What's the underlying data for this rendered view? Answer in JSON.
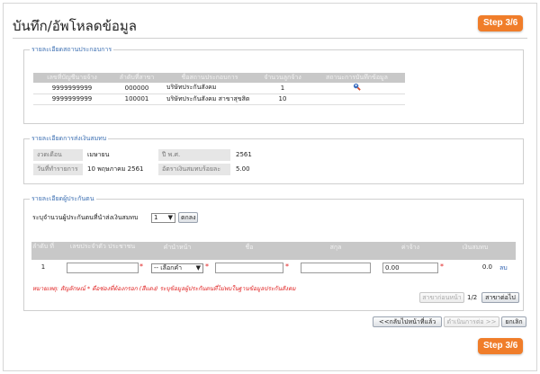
{
  "header": {
    "title": "บันทึก/อัพโหลดข้อมูล",
    "step": "Step 3/6"
  },
  "section1": {
    "legend": "รายละเอียดสถานประกอบการ",
    "columns": [
      "เลขที่บัญชีนายจ้าง",
      "ลำดับที่สาขา",
      "ชื่อสถานประกอบการ",
      "จำนวนลูกจ้าง",
      "สถานะการบันทึกข้อมูล"
    ],
    "rows": [
      {
        "account": "9999999999",
        "branch": "000000",
        "name": "บริษัทประกันสังคม",
        "employees": "1",
        "status_icon": "search-user-icon"
      },
      {
        "account": "9999999999",
        "branch": "100001",
        "name": "บริษัทประกันสังคม สาขาสุขสิต",
        "employees": "10",
        "status_icon": ""
      }
    ]
  },
  "section2": {
    "legend": "รายละเอียดการส่งเงินสมทบ",
    "period_label": "งวดเดือน",
    "period_value": "เมษายน",
    "year_label": "ปี พ.ศ.",
    "year_value": "2561",
    "date_label": "วันที่ทำรายการ",
    "date_value": "10 พฤษภาคม 2561",
    "rate_label": "อัตราเงินสมทบร้อยละ",
    "rate_value": "5.00"
  },
  "section3": {
    "legend": "รายละเอียดผู้ประกันตน",
    "count_label": "ระบุจำนวนผู้ประกันตนที่นำส่งเงินสมทบ",
    "count_value": "1",
    "count_button": "ตกลง",
    "columns": [
      "ลำดับ ที่",
      "เลขประจำตัว ประชาชน",
      "คำนำหน้า",
      "ชื่อ",
      "สกุล",
      "ค่าจ้าง",
      "เงินสมทบ"
    ],
    "row": {
      "no": "1",
      "id": "",
      "prefix": "-- เลือกคำ",
      "first": "",
      "last": "",
      "wage": "0.00",
      "contribution": "0.0",
      "delete": "ลบ"
    },
    "note": "หมายเหตุ: สัญลักษณ์ * คือช่องที่ต้องกรอก (สีแดง) ระบุข้อมูลผู้ประกันตนที่ไม่พบในฐานข้อมูลประกันสังคม",
    "pager": {
      "prev": "สาขาก่อนหน้า",
      "page": "1/2",
      "next": "สาขาต่อไป"
    }
  },
  "footer": {
    "back": "<<กลับไปหน้าที่แล้ว",
    "next": "ดำเนินการต่อ >>",
    "cancel": "ยกเลิก"
  },
  "colors": {
    "accent": "#f07d2a",
    "legend": "#3c6fb2",
    "required": "#e02020",
    "link": "#2b5fb0"
  }
}
